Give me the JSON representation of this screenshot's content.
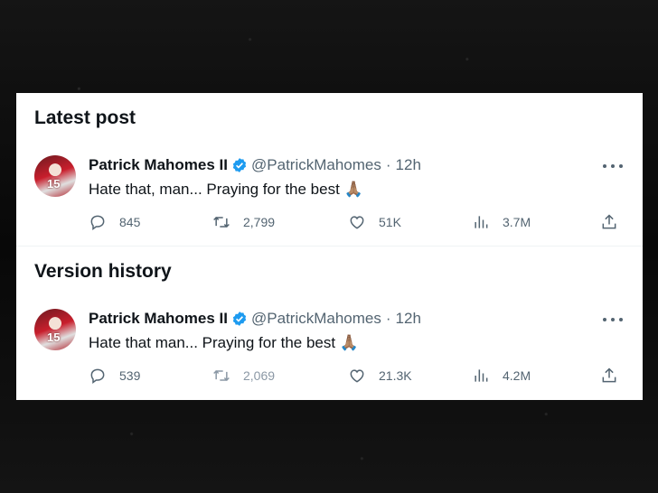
{
  "sections": [
    {
      "title": "Latest post",
      "tweet": {
        "name": "Patrick Mahomes II",
        "handle": "@PatrickMahomes",
        "separator": "·",
        "time": "12h",
        "avatar_number": "15",
        "text": "Hate that, man... Praying for the best",
        "emoji": "🙏🏽",
        "replies": "845",
        "retweets": "2,799",
        "likes": "51K",
        "views": "3.7M"
      }
    },
    {
      "title": "Version history",
      "tweet": {
        "name": "Patrick Mahomes II",
        "handle": "@PatrickMahomes",
        "separator": "·",
        "time": "12h",
        "avatar_number": "15",
        "text": "Hate that man... Praying for the best",
        "emoji": "🙏🏽",
        "replies": "539",
        "retweets": "2,069",
        "likes": "21.3K",
        "views": "4.2M"
      }
    }
  ],
  "icons": {
    "verified": "verified-badge-icon",
    "more": "more-icon",
    "reply": "reply-icon",
    "retweet": "retweet-icon",
    "like": "heart-icon",
    "views": "views-icon",
    "share": "share-icon"
  },
  "colors": {
    "text": "#0f1419",
    "muted": "#536471",
    "verified": "#1d9bf0",
    "background": "#0d0d0d",
    "card": "#ffffff"
  }
}
